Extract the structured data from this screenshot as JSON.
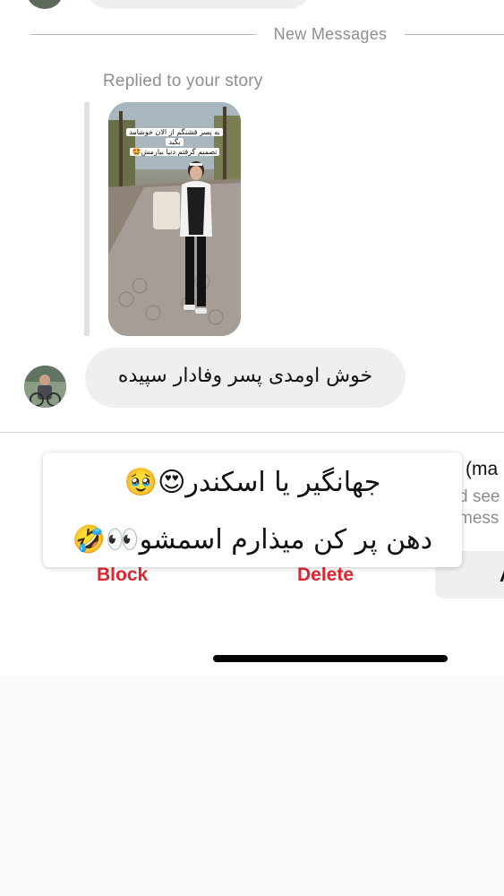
{
  "divider": {
    "label": "New Messages"
  },
  "story_reply": {
    "label": "Replied to your story",
    "caption_lines": [
      "به پسر قشنگم از الان خوشامد",
      "بگید",
      "تصمیم گرفتم دنیا بیارمش🤩"
    ]
  },
  "message": {
    "text": "خوش اومدی پسر وفادار سپیده"
  },
  "request": {
    "title": "(ma",
    "subtitle_1": "d see",
    "subtitle_2": "mess",
    "block_label": "Block",
    "delete_label": "Delete",
    "accept_label": "A"
  },
  "overlay_note": {
    "line_1": "جهانگیر یا اسکندر😍🥹",
    "line_2": "دهن پر کن میذارم اسمشو👀🤣"
  },
  "colors": {
    "destructive": "#e0252f",
    "bubble": "#efefef",
    "muted_text": "#8e8e8e"
  }
}
